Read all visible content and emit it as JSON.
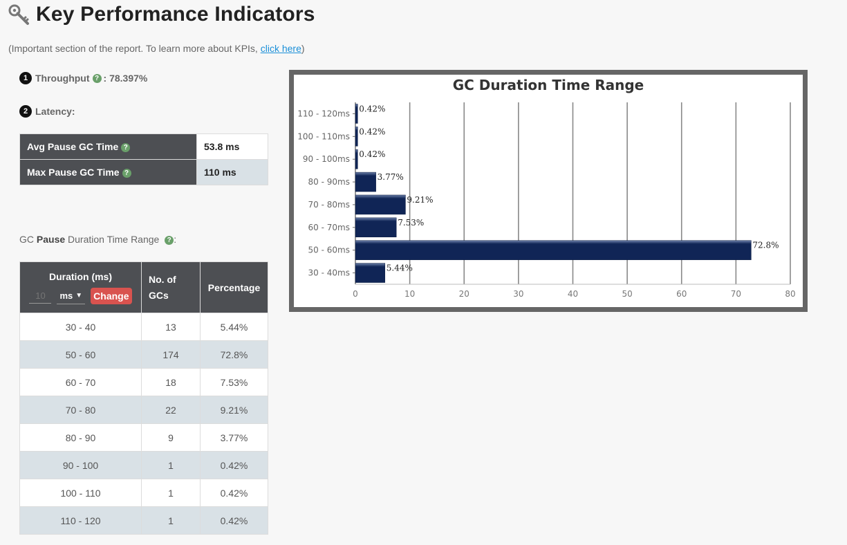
{
  "header": {
    "title": "Key Performance Indicators",
    "icon": "key-icon"
  },
  "subtitle": {
    "prefix": "(Important section of the report. To learn more about KPIs, ",
    "link": "click here",
    "suffix": ")"
  },
  "throughput": {
    "number": "1",
    "label": "Throughput",
    "value": ": 78.397%"
  },
  "latency": {
    "number": "2",
    "label": "Latency:"
  },
  "latency_table": [
    {
      "label": "Avg Pause GC Time",
      "value": "53.8 ms"
    },
    {
      "label": "Max Pause GC Time",
      "value": "110 ms"
    }
  ],
  "range_caption": {
    "pre": "GC ",
    "bold": "Pause",
    "post": " Duration Time Range",
    "colon": ":"
  },
  "dist_table": {
    "headers": {
      "duration": "Duration (ms)",
      "count": "No. of GCs",
      "percent": "Percentage"
    },
    "unit_input_placeholder": "10",
    "unit_select": "ms",
    "change_button": "Change",
    "rows": [
      {
        "range": "30 - 40",
        "count": "13",
        "percent": "5.44%"
      },
      {
        "range": "50 - 60",
        "count": "174",
        "percent": "72.8%"
      },
      {
        "range": "60 - 70",
        "count": "18",
        "percent": "7.53%"
      },
      {
        "range": "70 - 80",
        "count": "22",
        "percent": "9.21%"
      },
      {
        "range": "80 - 90",
        "count": "9",
        "percent": "3.77%"
      },
      {
        "range": "90 - 100",
        "count": "1",
        "percent": "0.42%"
      },
      {
        "range": "100 - 110",
        "count": "1",
        "percent": "0.42%"
      },
      {
        "range": "110 - 120",
        "count": "1",
        "percent": "0.42%"
      }
    ]
  },
  "colors": {
    "bar": "#102556",
    "header_bg": "#4d4f53",
    "row_alt": "#d9e1e6",
    "change": "#d9534f",
    "link": "#1a8fd8",
    "help": "#6aa06a"
  },
  "chart_data": {
    "type": "bar",
    "orientation": "horizontal",
    "title": "GC Duration Time Range",
    "categories": [
      "110 - 120ms",
      "100 - 110ms",
      "90 - 100ms",
      "80 - 90ms",
      "70 - 80ms",
      "60 - 70ms",
      "50 - 60ms",
      "30 - 40ms"
    ],
    "values": [
      0.42,
      0.42,
      0.42,
      3.77,
      9.21,
      7.53,
      72.8,
      5.44
    ],
    "labels": [
      "0.42%",
      "0.42%",
      "0.42%",
      "3.77%",
      "9.21%",
      "7.53%",
      "72.8%",
      "5.44%"
    ],
    "xticks": [
      "0",
      "10",
      "20",
      "30",
      "40",
      "50",
      "60",
      "70",
      "80"
    ],
    "xlim": [
      0,
      80
    ],
    "grid": true
  }
}
